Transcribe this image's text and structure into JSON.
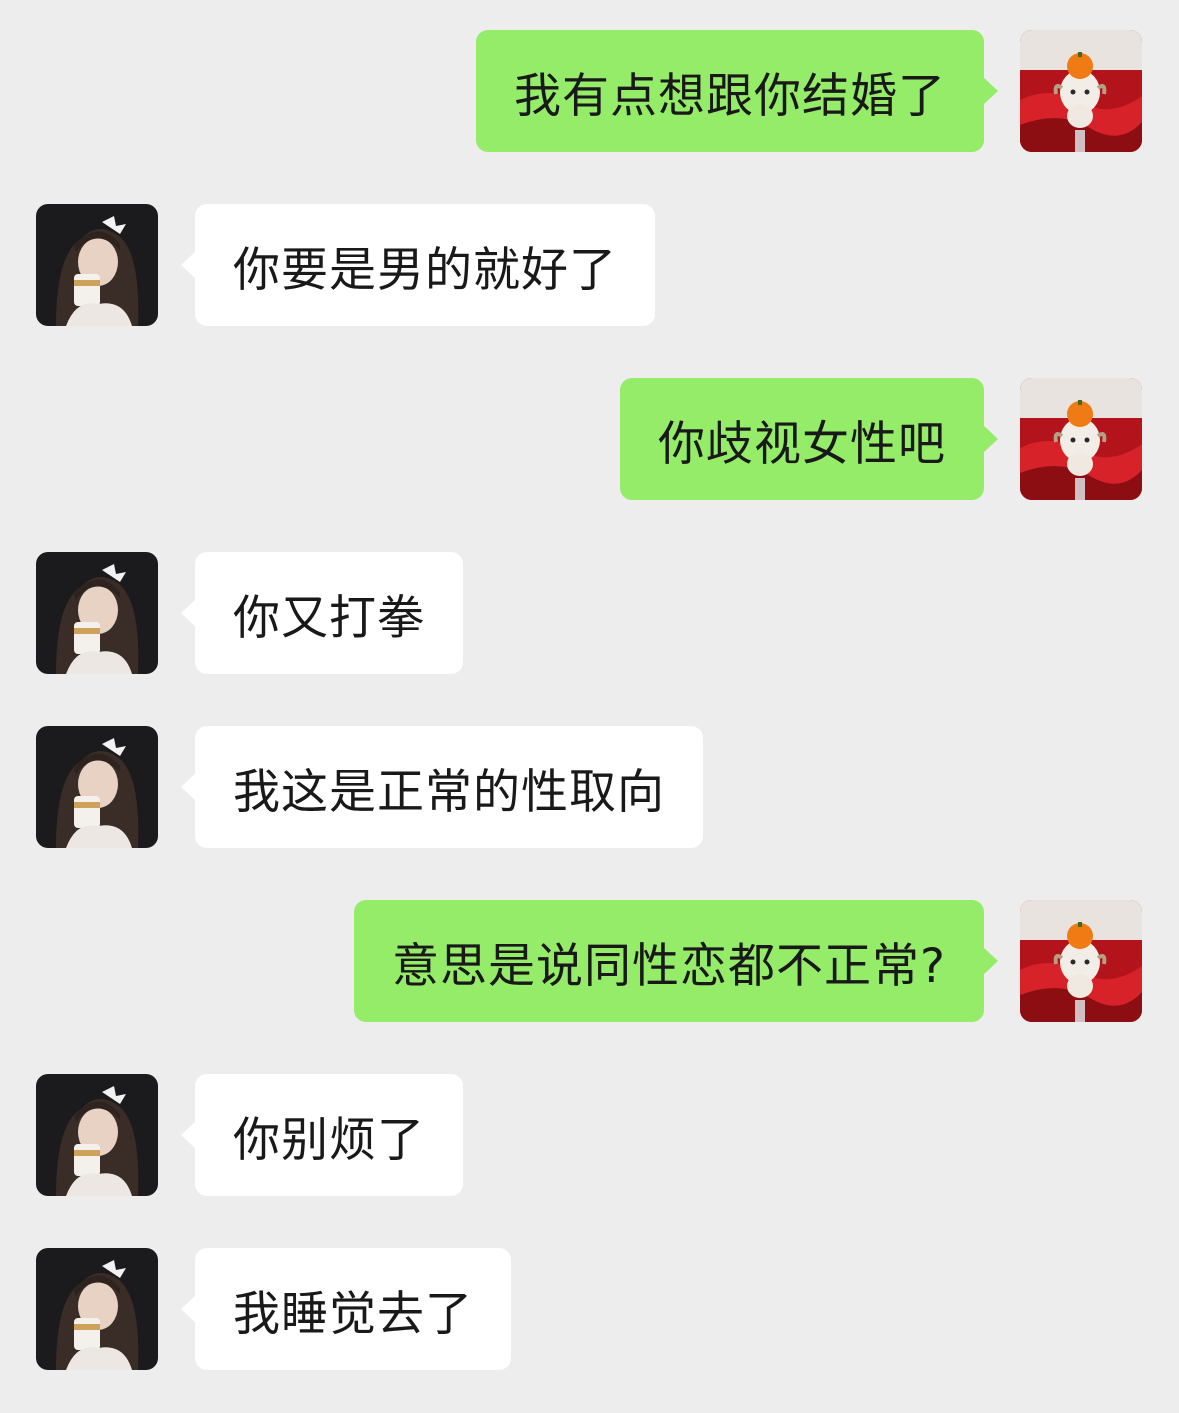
{
  "chat": {
    "messages": [
      {
        "side": "right",
        "text": "我有点想跟你结婚了",
        "avatar": "sheep-toy-avatar-icon"
      },
      {
        "side": "left",
        "text": "你要是男的就好了",
        "avatar": "girl-photo-avatar-icon"
      },
      {
        "side": "right",
        "text": "你歧视女性吧",
        "avatar": "sheep-toy-avatar-icon"
      },
      {
        "side": "left",
        "text": "你又打拳",
        "avatar": "girl-photo-avatar-icon"
      },
      {
        "side": "left",
        "text": "我这是正常的性取向",
        "avatar": "girl-photo-avatar-icon"
      },
      {
        "side": "right",
        "text": "意思是说同性恋都不正常?",
        "avatar": "sheep-toy-avatar-icon"
      },
      {
        "side": "left",
        "text": "你别烦了",
        "avatar": "girl-photo-avatar-icon"
      },
      {
        "side": "left",
        "text": "我睡觉去了",
        "avatar": "girl-photo-avatar-icon"
      }
    ]
  },
  "colors": {
    "background": "#ededed",
    "sent_bubble": "#95ec69",
    "received_bubble": "#ffffff",
    "text": "#191919"
  }
}
